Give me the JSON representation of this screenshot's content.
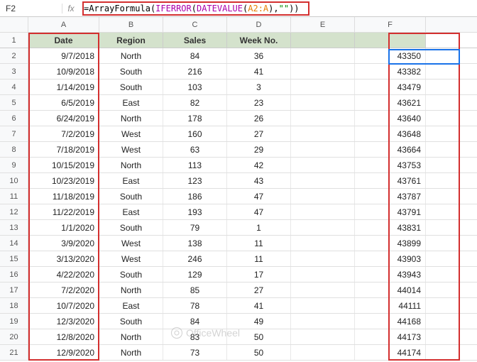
{
  "nameBox": "F2",
  "formula": {
    "p1": "=",
    "p2": "ArrayFormula",
    "p3": "(",
    "p4": "IFERROR",
    "p5": "(",
    "p6": "DATEVALUE",
    "p7": "(",
    "p8": "A2:A",
    "p9": ")",
    "p10": ",",
    "p11": "\"\"",
    "p12": "))"
  },
  "cols": [
    "A",
    "B",
    "C",
    "D",
    "E",
    "F"
  ],
  "head": {
    "a": "Date",
    "b": "Region",
    "c": "Sales",
    "d": "Week No."
  },
  "rows": [
    {
      "n": "1"
    },
    {
      "n": "2",
      "a": "9/7/2018",
      "b": "North",
      "c": "84",
      "d": "36",
      "f": "43350"
    },
    {
      "n": "3",
      "a": "10/9/2018",
      "b": "South",
      "c": "216",
      "d": "41",
      "f": "43382"
    },
    {
      "n": "4",
      "a": "1/14/2019",
      "b": "South",
      "c": "103",
      "d": "3",
      "f": "43479"
    },
    {
      "n": "5",
      "a": "6/5/2019",
      "b": "East",
      "c": "82",
      "d": "23",
      "f": "43621"
    },
    {
      "n": "6",
      "a": "6/24/2019",
      "b": "North",
      "c": "178",
      "d": "26",
      "f": "43640"
    },
    {
      "n": "7",
      "a": "7/2/2019",
      "b": "West",
      "c": "160",
      "d": "27",
      "f": "43648"
    },
    {
      "n": "8",
      "a": "7/18/2019",
      "b": "West",
      "c": "63",
      "d": "29",
      "f": "43664"
    },
    {
      "n": "9",
      "a": "10/15/2019",
      "b": "North",
      "c": "113",
      "d": "42",
      "f": "43753"
    },
    {
      "n": "10",
      "a": "10/23/2019",
      "b": "East",
      "c": "123",
      "d": "43",
      "f": "43761"
    },
    {
      "n": "11",
      "a": "11/18/2019",
      "b": "South",
      "c": "186",
      "d": "47",
      "f": "43787"
    },
    {
      "n": "12",
      "a": "11/22/2019",
      "b": "East",
      "c": "193",
      "d": "47",
      "f": "43791"
    },
    {
      "n": "13",
      "a": "1/1/2020",
      "b": "South",
      "c": "79",
      "d": "1",
      "f": "43831"
    },
    {
      "n": "14",
      "a": "3/9/2020",
      "b": "West",
      "c": "138",
      "d": "11",
      "f": "43899"
    },
    {
      "n": "15",
      "a": "3/13/2020",
      "b": "West",
      "c": "246",
      "d": "11",
      "f": "43903"
    },
    {
      "n": "16",
      "a": "4/22/2020",
      "b": "South",
      "c": "129",
      "d": "17",
      "f": "43943"
    },
    {
      "n": "17",
      "a": "7/2/2020",
      "b": "North",
      "c": "85",
      "d": "27",
      "f": "44014"
    },
    {
      "n": "18",
      "a": "10/7/2020",
      "b": "East",
      "c": "78",
      "d": "41",
      "f": "44111"
    },
    {
      "n": "19",
      "a": "12/3/2020",
      "b": "South",
      "c": "84",
      "d": "49",
      "f": "44168"
    },
    {
      "n": "20",
      "a": "12/8/2020",
      "b": "North",
      "c": "83",
      "d": "50",
      "f": "44173"
    },
    {
      "n": "21",
      "a": "12/9/2020",
      "b": "North",
      "c": "73",
      "d": "50",
      "f": "44174"
    }
  ],
  "watermark": "OfficeWheel"
}
